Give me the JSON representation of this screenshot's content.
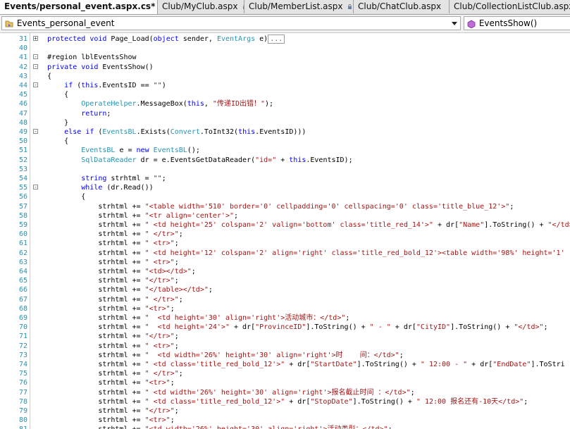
{
  "tabs": [
    {
      "label": "Events/personal_event.aspx.cs*",
      "active": true,
      "locked": true
    },
    {
      "label": "Club/MyClub.aspx",
      "active": false,
      "locked": true
    },
    {
      "label": "Club/MemberList.aspx",
      "active": false,
      "locked": true
    },
    {
      "label": "Club/ChatClub.aspx",
      "active": false,
      "locked": false
    },
    {
      "label": "Club/CollectionListClub.aspx",
      "active": false,
      "locked": false
    }
  ],
  "nav": {
    "class_combo": "Events_personal_event",
    "member_combo": "EventsShow()"
  },
  "colors": {
    "keyword": "#0000ff",
    "type": "#2b91af",
    "string": "#a31515",
    "line_number": "#2b91af"
  },
  "lines": [
    {
      "n": "31",
      "segs": [
        [
          "    protected void Page_Load(object sender, ",
          ""
        ],
        [
          "EventArgs",
          "ty"
        ],
        [
          " e)",
          ""
        ],
        [
          "...",
          "collapsed"
        ]
      ]
    },
    {
      "n": "40",
      "segs": [
        [
          "",
          ""
        ]
      ]
    },
    {
      "n": "41",
      "segs": [
        [
          "    #region lblEventsShow",
          ""
        ]
      ]
    },
    {
      "n": "42",
      "segs": [
        [
          "    private void EventsShow()",
          ""
        ]
      ]
    },
    {
      "n": "43",
      "segs": [
        [
          "    {",
          ""
        ]
      ]
    },
    {
      "n": "44",
      "segs": [
        [
          "        if (this.EventsID == \"\")",
          ""
        ]
      ]
    },
    {
      "n": "45",
      "segs": [
        [
          "        {",
          ""
        ]
      ]
    },
    {
      "n": "46",
      "segs": [
        [
          "            ",
          ""
        ],
        [
          "OperateHelper",
          "ty"
        ],
        [
          ".MessageBox(this, \"传递ID出错！\");",
          ""
        ]
      ]
    },
    {
      "n": "47",
      "segs": [
        [
          "            return;",
          ""
        ]
      ]
    },
    {
      "n": "48",
      "segs": [
        [
          "        }",
          ""
        ]
      ]
    },
    {
      "n": "49",
      "segs": [
        [
          "        else if (",
          ""
        ],
        [
          "EventsBL",
          "ty"
        ],
        [
          ".Exists(",
          ""
        ],
        [
          "Convert",
          "ty"
        ],
        [
          ".ToInt32(this.EventsID)))",
          ""
        ]
      ]
    },
    {
      "n": "50",
      "segs": [
        [
          "        {",
          ""
        ]
      ]
    },
    {
      "n": "51",
      "segs": [
        [
          "            ",
          ""
        ],
        [
          "EventsBL",
          "ty"
        ],
        [
          " e = new ",
          ""
        ],
        [
          "EventsBL",
          "ty"
        ],
        [
          "();",
          ""
        ]
      ]
    },
    {
      "n": "52",
      "segs": [
        [
          "            ",
          ""
        ],
        [
          "SqlDataReader",
          "ty"
        ],
        [
          " dr = e.EventsGetDataReader(\"id=\" + this.EventsID);",
          ""
        ]
      ]
    },
    {
      "n": "53",
      "segs": [
        [
          "",
          ""
        ]
      ]
    },
    {
      "n": "54",
      "segs": [
        [
          "            string strhtml = \"\";",
          ""
        ]
      ]
    },
    {
      "n": "55",
      "segs": [
        [
          "            while (dr.Read())",
          ""
        ]
      ]
    },
    {
      "n": "56",
      "segs": [
        [
          "            {",
          ""
        ]
      ]
    },
    {
      "n": "57",
      "segs": [
        [
          "                strhtml += \"<table width='510' border='0' cellpadding='0' cellspacing='0' class='title_blue_12'>\";",
          ""
        ]
      ]
    },
    {
      "n": "58",
      "segs": [
        [
          "                strhtml += \"<tr align='center'>\";",
          ""
        ]
      ]
    },
    {
      "n": "59",
      "segs": [
        [
          "                strhtml += \" <td height='25' colspan='2' valign='bottom' class='title_red_14'>\" + dr[\"Name\"].ToString() + \"</td>",
          ""
        ]
      ]
    },
    {
      "n": "60",
      "segs": [
        [
          "                strhtml += \" </tr>\";",
          ""
        ]
      ]
    },
    {
      "n": "61",
      "segs": [
        [
          "                strhtml += \" <tr>\";",
          ""
        ]
      ]
    },
    {
      "n": "62",
      "segs": [
        [
          "                strhtml += \" <td height='12' colspan='2' align='right' class='title_red_bold_12'><table width='98%' height='1'",
          ""
        ]
      ]
    },
    {
      "n": "63",
      "segs": [
        [
          "                strhtml += \" <tr>\";",
          ""
        ]
      ]
    },
    {
      "n": "64",
      "segs": [
        [
          "                strhtml += \"<td></td>\";",
          ""
        ]
      ]
    },
    {
      "n": "65",
      "segs": [
        [
          "                strhtml += \"</tr>\";",
          ""
        ]
      ]
    },
    {
      "n": "66",
      "segs": [
        [
          "                strhtml += \"</table></td>\";",
          ""
        ]
      ]
    },
    {
      "n": "67",
      "segs": [
        [
          "                strhtml += \" </tr>\";",
          ""
        ]
      ]
    },
    {
      "n": "68",
      "segs": [
        [
          "                strhtml += \"<tr>\";",
          ""
        ]
      ]
    },
    {
      "n": "69",
      "segs": [
        [
          "                strhtml += \"  <td height='30' align='right'>活动城市：</td>\";",
          ""
        ]
      ]
    },
    {
      "n": "70",
      "segs": [
        [
          "                strhtml += \"  <td height='24'>\" + dr[\"ProvinceID\"].ToString() + \" - \" + dr[\"CityID\"].ToString() + \"</td>\";",
          ""
        ]
      ]
    },
    {
      "n": "71",
      "segs": [
        [
          "                strhtml += \"</tr>\";",
          ""
        ]
      ]
    },
    {
      "n": "72",
      "segs": [
        [
          "                strhtml += \" <tr>\";",
          ""
        ]
      ]
    },
    {
      "n": "73",
      "segs": [
        [
          "                strhtml += \"  <td width='26%' height='30' align='right'>时    间：</td>\";",
          ""
        ]
      ]
    },
    {
      "n": "74",
      "segs": [
        [
          "                strhtml += \" <td class='title_red_bold_12'>\" + dr[\"StartDate\"].ToString() + \" 12:00 - \" + dr[\"EndDate\"].ToStri",
          ""
        ]
      ]
    },
    {
      "n": "75",
      "segs": [
        [
          "                strhtml += \" </tr>\";",
          ""
        ]
      ]
    },
    {
      "n": "76",
      "segs": [
        [
          "                strhtml += \"<tr>\";",
          ""
        ]
      ]
    },
    {
      "n": "77",
      "segs": [
        [
          "                strhtml += \" <td width='26%' height='30' align='right'>报名截止时间 ：</td>\";",
          ""
        ]
      ]
    },
    {
      "n": "78",
      "segs": [
        [
          "                strhtml += \" <td class='title_red_bold_12'>\" + dr[\"StopDate\"].ToString() + \" 12:00 报名还有-10天</td>\";",
          ""
        ]
      ]
    },
    {
      "n": "79",
      "segs": [
        [
          "                strhtml += \"</tr>\";",
          ""
        ]
      ]
    },
    {
      "n": "80",
      "segs": [
        [
          "                strhtml += \"<tr>\";",
          ""
        ]
      ]
    },
    {
      "n": "81",
      "segs": [
        [
          "                strhtml += \"<td width='26%' height='30' align='right'>活动类型：</td>\";",
          ""
        ]
      ]
    }
  ]
}
